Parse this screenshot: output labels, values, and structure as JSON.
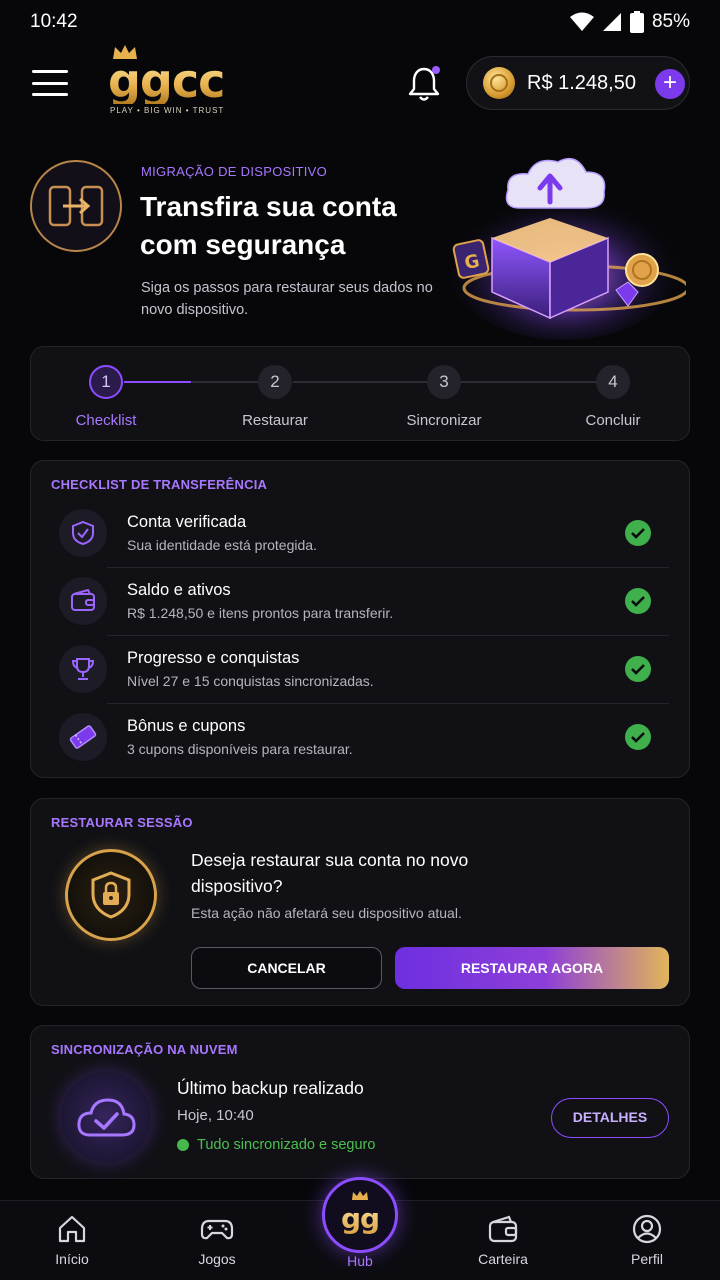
{
  "status_bar": {
    "time": "10:42",
    "battery": "85%"
  },
  "header": {
    "logo_text": "ggcc",
    "logo_tagline": "PLAY • BIG WIN • TRUST",
    "balance": "R$ 1.248,50",
    "plus_symbol": "+"
  },
  "hero": {
    "eyebrow": "MIGRAÇÃO DE DISPOSITIVO",
    "title": "Transfira sua conta com segurança",
    "subtitle": "Siga os passos para restaurar seus dados no novo dispositivo.",
    "art_badge": "G"
  },
  "stepper": {
    "steps": [
      {
        "number": "1",
        "label": "Checklist"
      },
      {
        "number": "2",
        "label": "Restaurar"
      },
      {
        "number": "3",
        "label": "Sincronizar"
      },
      {
        "number": "4",
        "label": "Concluir"
      }
    ]
  },
  "checklist": {
    "title": "CHECKLIST DE TRANSFERÊNCIA",
    "items": [
      {
        "title": "Conta verificada",
        "subtitle": "Sua identidade está protegida.",
        "icon": "shield-check-icon"
      },
      {
        "title": "Saldo e ativos",
        "subtitle": "R$ 1.248,50 e itens prontos para transferir.",
        "icon": "wallet-icon"
      },
      {
        "title": "Progresso e conquistas",
        "subtitle": "Nível 27 e 15 conquistas sincronizadas.",
        "icon": "trophy-icon"
      },
      {
        "title": "Bônus e cupons",
        "subtitle": "3 cupons disponíveis para restaurar.",
        "icon": "ticket-icon"
      }
    ]
  },
  "restore": {
    "title": "RESTAURAR SESSÃO",
    "question": "Deseja restaurar sua conta no novo dispositivo?",
    "note": "Esta ação não afetará seu dispositivo atual.",
    "cancel_label": "CANCELAR",
    "restore_label": "RESTAURAR AGORA"
  },
  "cloud": {
    "title": "SINCRONIZAÇÃO NA NUVEM",
    "backup_title": "Último backup realizado",
    "backup_time": "Hoje, 10:40",
    "status": "Tudo sincronizado e seguro",
    "details_label": "DETALHES"
  },
  "bottom_nav": {
    "items": [
      {
        "label": "Início",
        "icon": "home-icon"
      },
      {
        "label": "Jogos",
        "icon": "gamepad-icon"
      },
      {
        "label": "Hub",
        "icon": "hub-logo"
      },
      {
        "label": "Carteira",
        "icon": "wallet-icon"
      },
      {
        "label": "Perfil",
        "icon": "profile-icon"
      }
    ],
    "hub_logo": "gg"
  },
  "colors": {
    "accent": "#8b4dff",
    "gold": "#e0b55a",
    "success": "#3fb04b",
    "background": "#07070a",
    "card": "#111115"
  }
}
